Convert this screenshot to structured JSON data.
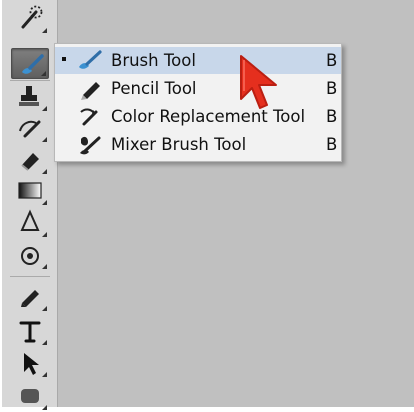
{
  "toolbar": {
    "tools": [
      {
        "name": "quick-selection-tool"
      },
      {
        "name": "brush-tool",
        "active": true
      },
      {
        "name": "clone-stamp-tool"
      },
      {
        "name": "history-brush-tool"
      },
      {
        "name": "eraser-tool"
      },
      {
        "name": "gradient-tool"
      },
      {
        "name": "blur-tool"
      },
      {
        "name": "dodge-tool"
      },
      {
        "name": "pen-tool"
      },
      {
        "name": "type-tool"
      },
      {
        "name": "path-selection-tool"
      },
      {
        "name": "shape-tool"
      }
    ]
  },
  "menu": {
    "items": [
      {
        "label": "Brush Tool",
        "shortcut": "B",
        "icon": "brush-icon",
        "selected": true
      },
      {
        "label": "Pencil Tool",
        "shortcut": "B",
        "icon": "pencil-icon",
        "selected": false
      },
      {
        "label": "Color Replacement Tool",
        "shortcut": "B",
        "icon": "color-replacement-icon",
        "selected": false
      },
      {
        "label": "Mixer Brush Tool",
        "shortcut": "B",
        "icon": "mixer-brush-icon",
        "selected": false
      }
    ]
  },
  "colors": {
    "workspace": "#c0c0c0",
    "toolbar": "#d7d7d7",
    "menu_background": "#f2f2f2",
    "menu_highlight": "#c8d7ea",
    "cursor_red": "#e52f1e"
  }
}
